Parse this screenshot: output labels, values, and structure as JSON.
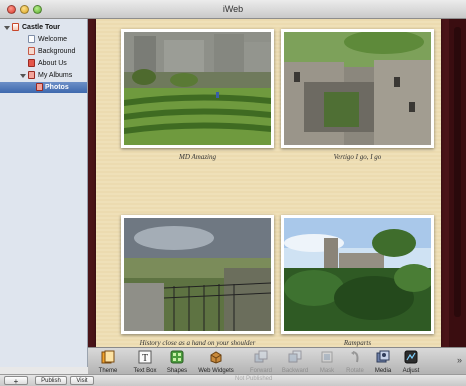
{
  "window": {
    "title": "iWeb"
  },
  "sidebar": {
    "items": [
      {
        "label": "Castle Tour"
      },
      {
        "label": "Welcome"
      },
      {
        "label": "Background"
      },
      {
        "label": "About Us"
      },
      {
        "label": "My Albums"
      },
      {
        "label": "Photos"
      }
    ]
  },
  "page": {
    "captions": [
      "MD Amazing",
      "Vertigo I go, I go",
      "History close as a hand on your shoulder",
      "Ramparts"
    ]
  },
  "toolbar": {
    "items": [
      {
        "label": "Theme",
        "icon": "theme-icon",
        "enabled": true
      },
      {
        "label": "Text Box",
        "icon": "text-box-icon",
        "enabled": true
      },
      {
        "label": "Shapes",
        "icon": "shapes-icon",
        "enabled": true
      },
      {
        "label": "Web Widgets",
        "icon": "web-widgets-icon",
        "enabled": true
      },
      {
        "label": "Forward",
        "icon": "forward-icon",
        "enabled": false
      },
      {
        "label": "Backward",
        "icon": "backward-icon",
        "enabled": false
      },
      {
        "label": "Mask",
        "icon": "mask-icon",
        "enabled": false
      },
      {
        "label": "Rotate",
        "icon": "rotate-icon",
        "enabled": false
      },
      {
        "label": "Media",
        "icon": "media-icon",
        "enabled": true
      },
      {
        "label": "Adjust",
        "icon": "adjust-icon",
        "enabled": true
      }
    ],
    "more": "»"
  },
  "bottom": {
    "add": "+",
    "publish": "Publish",
    "visit": "Visit",
    "status": "Not Published"
  },
  "colors": {
    "selection": "#3e68ad",
    "canvas": "#4a1418",
    "paper": "#efe0b8"
  }
}
